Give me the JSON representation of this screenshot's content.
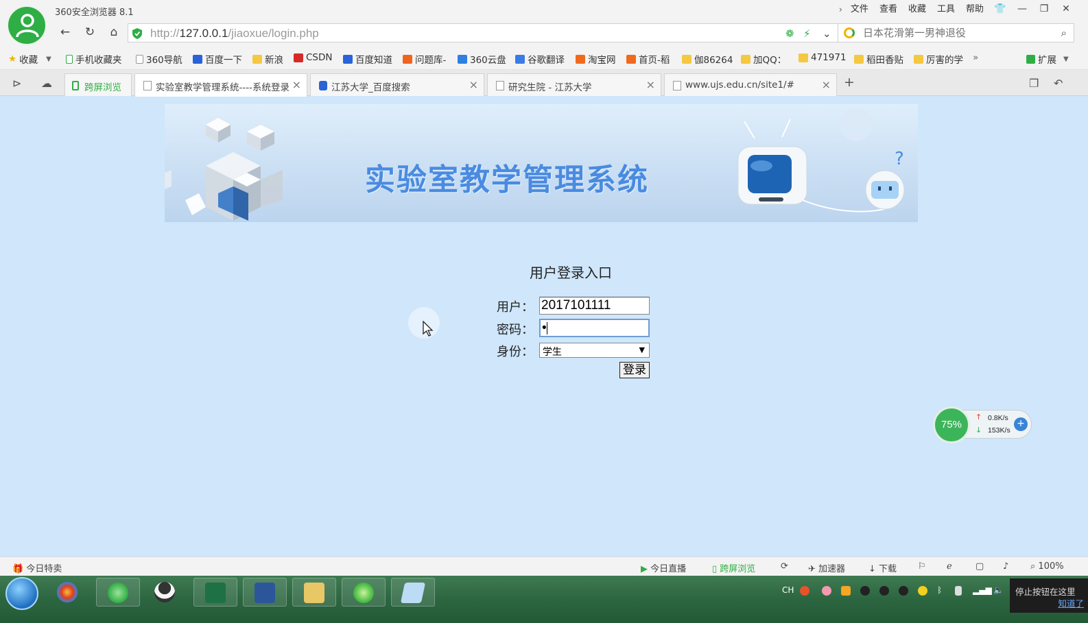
{
  "window": {
    "title": "360安全浏览器 8.1",
    "menu": [
      "文件",
      "查看",
      "收藏",
      "工具",
      "帮助"
    ]
  },
  "nav": {
    "url_scheme": "http://",
    "url_host": "127.0.0.1",
    "url_path": "/jiaoxue/login.php",
    "search_placeholder": "日本花滑第一男神退役"
  },
  "bookmarks": [
    {
      "label": "收藏",
      "icon": "star-icon"
    },
    {
      "label": "手机收藏夹",
      "icon": "phone-icon"
    },
    {
      "label": "360导航",
      "icon": "page-icon"
    },
    {
      "label": "百度一下",
      "icon": "baidu-icon"
    },
    {
      "label": "新浪",
      "icon": "folder-icon"
    },
    {
      "label": "CSDN",
      "icon": "csdn-icon"
    },
    {
      "label": "百度知道",
      "icon": "baidu-icon"
    },
    {
      "label": "问题库-",
      "icon": "sogou-icon"
    },
    {
      "label": "360云盘",
      "icon": "cloud-icon"
    },
    {
      "label": "谷歌翻译",
      "icon": "translate-icon"
    },
    {
      "label": "淘宝网",
      "icon": "taobao-icon"
    },
    {
      "label": "首页-稻",
      "icon": "taobao-icon"
    },
    {
      "label": "伽86264",
      "icon": "folder-icon"
    },
    {
      "label": "加QQ：",
      "icon": "folder-icon"
    },
    {
      "label": "471971",
      "icon": "folder-icon"
    },
    {
      "label": "稻田香贴",
      "icon": "folder-icon"
    },
    {
      "label": "厉害的学",
      "icon": "folder-icon"
    }
  ],
  "bookmarks_extend": "扩展",
  "tabs": [
    {
      "label": "跨屏浏览",
      "active": false
    },
    {
      "label": "实验室教学管理系统----系统登录",
      "active": true
    },
    {
      "label": "江苏大学_百度搜索",
      "active": false
    },
    {
      "label": "研究生院 - 江苏大学",
      "active": false
    },
    {
      "label": "www.ujs.edu.cn/site1/#",
      "active": false
    }
  ],
  "page": {
    "banner_title": "实验室教学管理系统",
    "login_title": "用户登录入口",
    "user_label": "用户：",
    "user_value": "2017101111",
    "password_label": "密码：",
    "password_value": "•",
    "role_label": "身份：",
    "role_value": "学生",
    "login_button": "登录"
  },
  "speed_widget": {
    "percent": "75%",
    "upload": "0.8K/s",
    "download": "153K/s"
  },
  "statusbar": {
    "left": "今日特卖",
    "items": [
      "今日直播",
      "跨屏浏览",
      "加速器",
      "下载"
    ],
    "zoom": "100%"
  },
  "taskbar": {
    "lang": "CH",
    "notice_text": "停止按钮在这里",
    "notice_link": "知道了"
  }
}
